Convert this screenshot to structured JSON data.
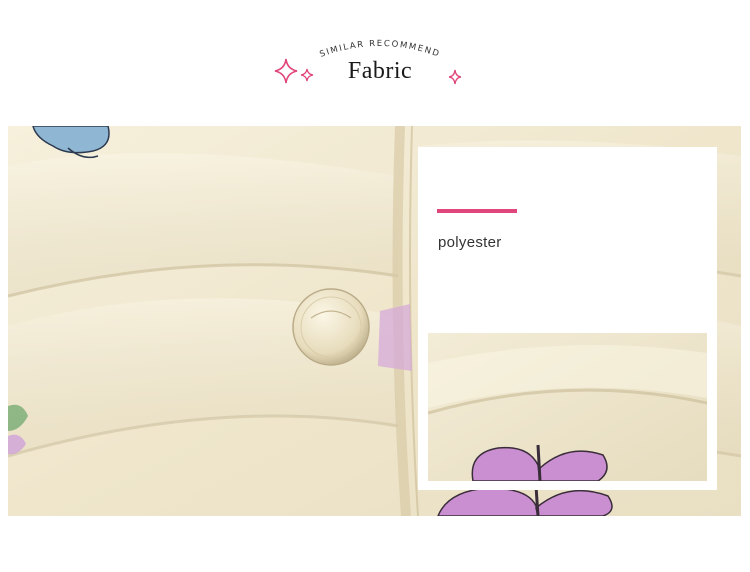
{
  "header": {
    "subtitle": "SIMILAR RECOMMEND",
    "title": "Fabric"
  },
  "card": {
    "material": "polyester"
  },
  "colors": {
    "accent": "#e0457b",
    "fabric": "#f2ebd5",
    "butterfly": "#c98fd0"
  },
  "icons": [
    "sparkle-icon",
    "snap-button",
    "butterfly-print"
  ]
}
